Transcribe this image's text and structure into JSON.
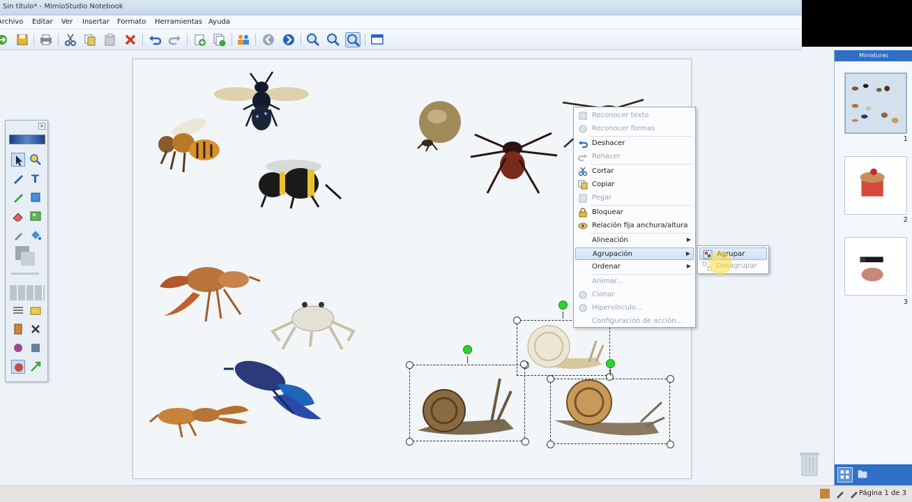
{
  "window": {
    "title": "Sin título* - MimioStudio Notebook"
  },
  "menu": [
    "Archivo",
    "Editar",
    "Ver",
    "Insertar",
    "Formato",
    "Herramientas",
    "Ayuda"
  ],
  "context_menu": {
    "items": [
      {
        "label": "Reconocer texto",
        "enabled": false,
        "icon": "text-recognize-icon"
      },
      {
        "label": "Reconocer formas",
        "enabled": false,
        "icon": "shape-recognize-icon"
      },
      {
        "label": "Deshacer",
        "enabled": true,
        "icon": "undo-icon"
      },
      {
        "label": "Rehacer",
        "enabled": false,
        "icon": "redo-icon"
      },
      {
        "label": "Cortar",
        "enabled": true,
        "icon": "cut-icon"
      },
      {
        "label": "Copiar",
        "enabled": true,
        "icon": "copy-icon"
      },
      {
        "label": "Pegar",
        "enabled": false,
        "icon": "paste-icon"
      },
      {
        "label": "Bloquear",
        "enabled": true,
        "icon": "lock-icon"
      },
      {
        "label": "Relación fija anchura/altura",
        "enabled": true,
        "icon": "aspect-ratio-icon"
      },
      {
        "label": "Alineación",
        "enabled": true,
        "submenu": true
      },
      {
        "label": "Agrupación",
        "enabled": true,
        "submenu": true,
        "highlighted": true
      },
      {
        "label": "Ordenar",
        "enabled": true,
        "submenu": true
      },
      {
        "label": "Animar...",
        "enabled": false
      },
      {
        "label": "Clonar",
        "enabled": false,
        "icon": "clone-icon"
      },
      {
        "label": "Hipervínculo...",
        "enabled": false,
        "icon": "hyperlink-icon"
      },
      {
        "label": "Configuración de acción...",
        "enabled": false
      }
    ]
  },
  "submenu": {
    "items": [
      {
        "label": "Agrupar",
        "enabled": true,
        "highlighted": true,
        "icon": "group-icon"
      },
      {
        "label": "Desagrupar",
        "enabled": false,
        "icon": "ungroup-icon"
      }
    ]
  },
  "sidebar": {
    "title": "Miniaturas",
    "pages": [
      {
        "number": "1",
        "selected": true
      },
      {
        "number": "2",
        "selected": false
      },
      {
        "number": "3",
        "selected": false
      }
    ]
  },
  "status": {
    "page": "Página 1 de 3"
  },
  "colors": {
    "accent": "#2f6fc6",
    "rotate_handle": "#2fd12f",
    "menu_highlight": "#cfe1f6"
  }
}
